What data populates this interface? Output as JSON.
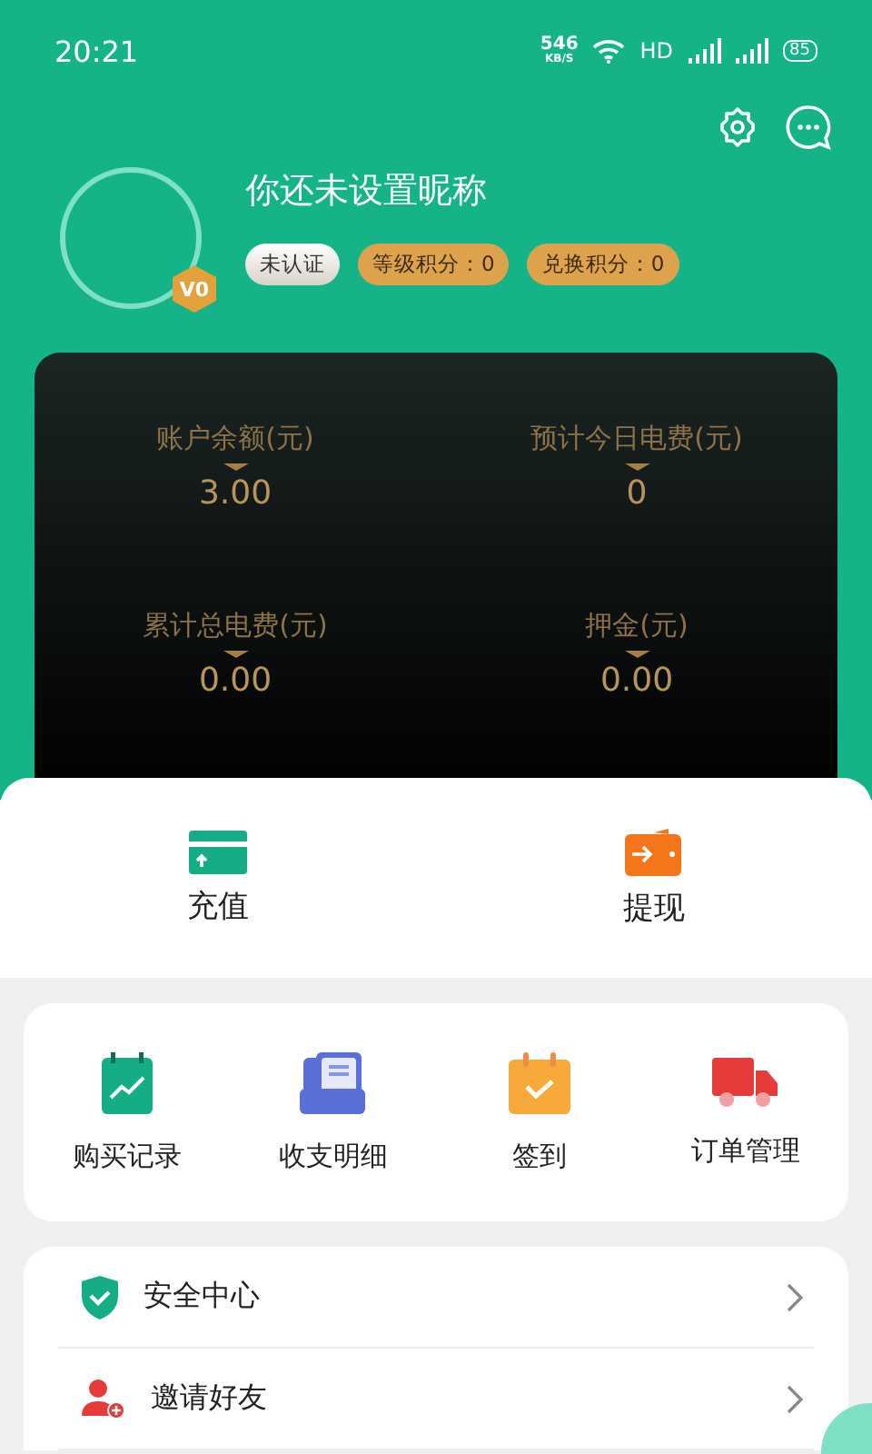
{
  "status_bar": {
    "time": "20:21",
    "net_speed": "546",
    "net_unit": "KB/S",
    "hd": "HD",
    "battery": "85"
  },
  "profile": {
    "nickname": "你还未设置昵称",
    "level_badge": "V0",
    "tags": [
      {
        "label": "未认证",
        "kind": "plain"
      },
      {
        "label": "等级积分：0",
        "kind": "gold"
      },
      {
        "label": "兑换积分：0",
        "kind": "gold"
      }
    ]
  },
  "account": {
    "stats": [
      {
        "label": "账户余额(元)",
        "value": "3.00"
      },
      {
        "label": "预计今日电费(元)",
        "value": "0"
      },
      {
        "label": "累计总电费(元)",
        "value": "0.00"
      },
      {
        "label": "押金(元)",
        "value": "0.00"
      }
    ]
  },
  "wallet_actions": [
    {
      "label": "充值"
    },
    {
      "label": "提现"
    }
  ],
  "shortcuts": [
    {
      "label": "购买记录"
    },
    {
      "label": "收支明细"
    },
    {
      "label": "签到"
    },
    {
      "label": "订单管理"
    }
  ],
  "menu": [
    {
      "label": "安全中心"
    },
    {
      "label": "邀请好友"
    }
  ]
}
